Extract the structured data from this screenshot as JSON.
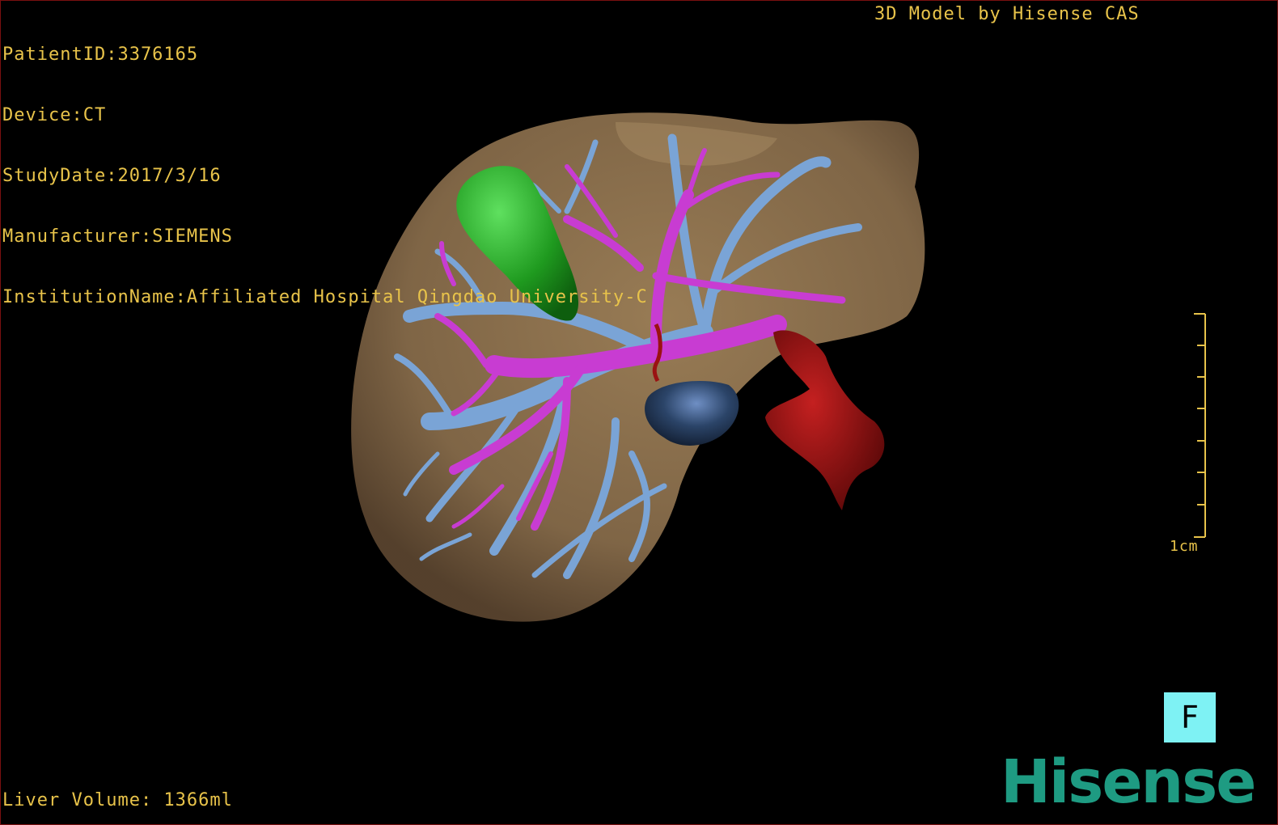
{
  "header": {
    "patient_id": "PatientID:3376165",
    "device": "Device:CT",
    "study_date": "StudyDate:2017/3/16",
    "manufacturer": "Manufacturer:SIEMENS",
    "institution": "InstitutionName:Affiliated Hospital Qingdao University-C"
  },
  "credit": "3D Model by Hisense CAS",
  "footer": {
    "liver_volume": "Liver Volume: 1366ml"
  },
  "scale_bar": {
    "label": "1cm"
  },
  "view_button": {
    "label": "F"
  },
  "brand": {
    "name": "Hisense"
  },
  "colors": {
    "overlay_text": "#e8c34a",
    "liver_surface": "#8a6e4c",
    "portal_vein": "#c83cd2",
    "hepatic_vein": "#7aa4d6",
    "gallbladder": "#2aa82a",
    "tumor_lesion": "#2b4468",
    "inferior_vena_cava_stump": "#9a1212",
    "view_button_bg": "#7ef2f4",
    "brand": "#1e9b82"
  },
  "icons": {
    "view_button": "front-view-icon"
  }
}
